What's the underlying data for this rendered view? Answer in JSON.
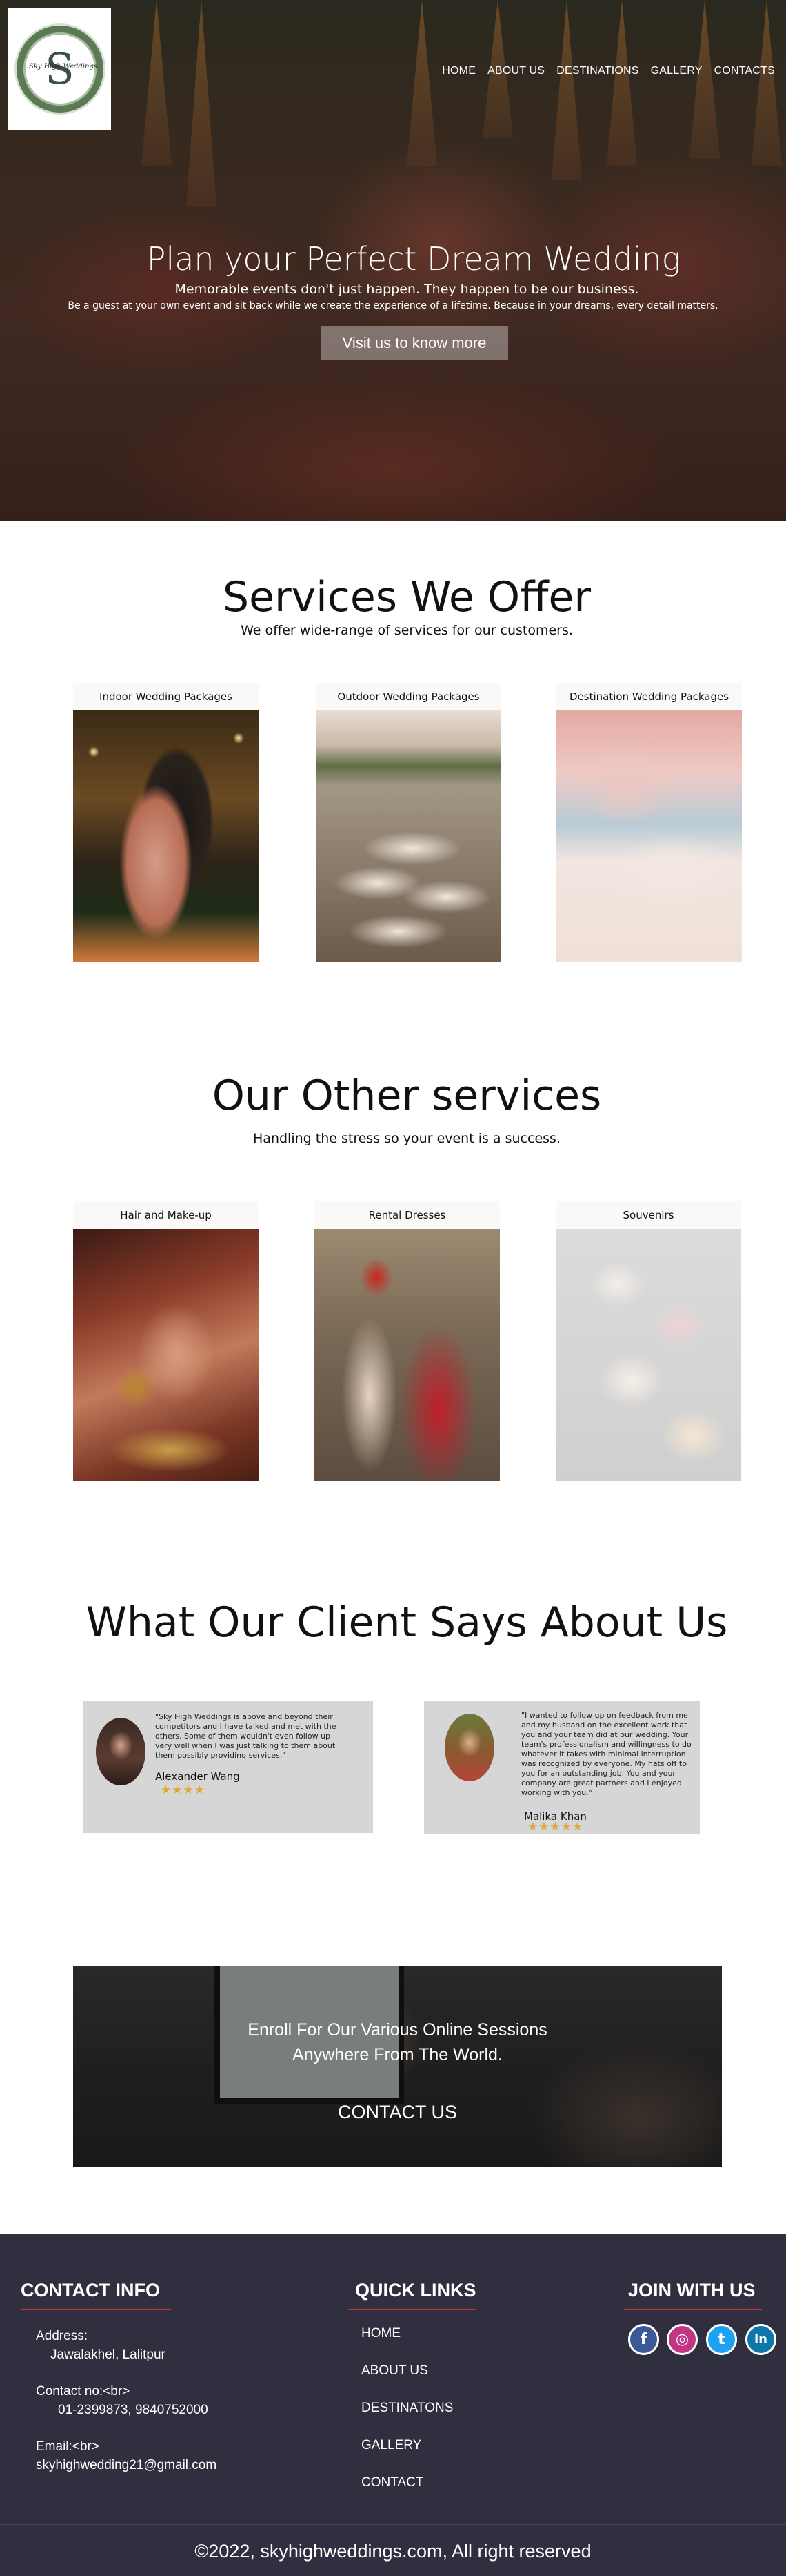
{
  "header": {
    "logo_letter": "S",
    "logo_text": "Sky High Weddings",
    "nav": [
      "HOME",
      "ABOUT US",
      "DESTINATIONS",
      "GALLERY",
      "CONTACTS"
    ]
  },
  "hero": {
    "title": "Plan your Perfect Dream Wedding",
    "subtitle": "Memorable events don't just happen. They happen to be our business.",
    "tagline": "Be a guest at your own event and sit back while we create the experience of a lifetime. Because in your dreams, every detail matters.",
    "button": "Visit us to know more"
  },
  "services": {
    "title": "Services We Offer",
    "subtitle": "We offer wide-range of services for our customers.",
    "items": [
      {
        "label": "Indoor Wedding Packages"
      },
      {
        "label": "Outdoor Wedding Packages"
      },
      {
        "label": "Destination Wedding Packages"
      }
    ]
  },
  "other_services": {
    "title": "Our Other services",
    "subtitle": "Handling the stress so your event is a success.",
    "items": [
      {
        "label": "Hair and Make-up"
      },
      {
        "label": "Rental Dresses"
      },
      {
        "label": "Souvenirs"
      }
    ]
  },
  "testimonials": {
    "title": "What Our Client Says About Us",
    "items": [
      {
        "quote": "\"Sky High Weddings is above and beyond their competitors and I have talked and met with the others. Some of them wouldn't even follow up very well when I was just talking to them about them possibly providing services.\"",
        "name": "Alexander Wang",
        "stars": "★★★★"
      },
      {
        "quote": "\"I wanted to follow up on feedback from me and my husband on the excellent work that you and your team did at our wedding. Your team's professionalism and willingness to do whatever it takes with minimal interruption was recognized by everyone. My hats off to you for an outstanding job. You and your company are great partners and I enjoyed working with you.\"",
        "name": "Malika Khan",
        "stars": "★★★★★"
      }
    ]
  },
  "enroll": {
    "line1": "Enroll For Our Various Online Sessions",
    "line2": "Anywhere From The World.",
    "button": "CONTACT US"
  },
  "footer": {
    "contact_title": "CONTACT INFO",
    "address_label": "Address:",
    "address": "Jawalakhel, Lalitpur",
    "phone_label": "Contact no:<br>",
    "phone": "01-2399873, 9840752000",
    "email_label": "Email:<br>",
    "email": "skyhighwedding21@gmail.com",
    "links_title": "QUICK LINKS",
    "links": [
      "HOME",
      "ABOUT US",
      "DESTINATONS",
      "GALLERY",
      "CONTACT"
    ],
    "social_title": "JOIN WITH US",
    "social": [
      {
        "icon": "facebook-icon",
        "glyph": "f",
        "color": "#3b5998"
      },
      {
        "icon": "instagram-icon",
        "glyph": "◎",
        "color": "#c13584"
      },
      {
        "icon": "twitter-icon",
        "glyph": "t",
        "color": "#1da1f2"
      },
      {
        "icon": "linkedin-icon",
        "glyph": "in",
        "color": "#0e76a8"
      }
    ],
    "copyright": "©2022, skyhighweddings.com, All right reserved"
  }
}
